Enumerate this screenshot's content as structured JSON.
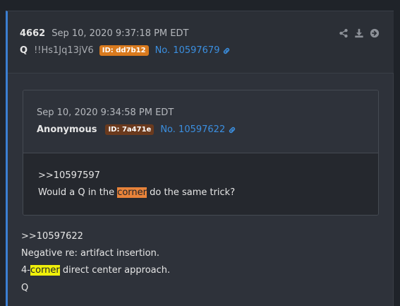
{
  "post": {
    "number": "4662",
    "date": "Sep 10, 2020 9:37:18 PM EDT",
    "name": "Q",
    "tripcode": "!!Hs1Jq13jV6",
    "id_badge": "ID: dd7b12",
    "link": "No. 10597679",
    "body": {
      "line1": ">>10597622",
      "line2": "Negative re: artifact insertion.",
      "line3_prefix": "4-",
      "line3_highlight": "corner",
      "line3_suffix": " direct center approach.",
      "line4": "Q"
    }
  },
  "quote": {
    "date": "Sep 10, 2020 9:34:58 PM EDT",
    "name": "Anonymous",
    "id_badge": "ID: 7a471e",
    "link": "No. 10597622",
    "body": {
      "line1": ">>10597597",
      "line2_prefix": "Would a Q in the ",
      "line2_highlight": "corner",
      "line2_suffix": " do the same trick?"
    }
  },
  "icons": [
    "share-icon",
    "download-icon",
    "forward-icon",
    "link-icon"
  ],
  "colors": {
    "accent_bar": "#3b7fd2",
    "link": "#3b8fe0",
    "badge_q": "#d97a1e",
    "badge_anon": "#6b3a1d",
    "highlight_quote": "#e8833a",
    "highlight_post": "#f0f00a"
  }
}
